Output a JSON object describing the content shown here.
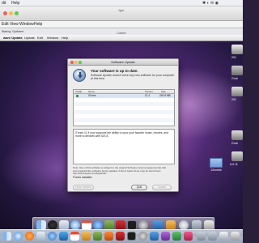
{
  "host_menubar": {
    "items": [
      "dit",
      "Help"
    ]
  },
  "host_window": {
    "title": "Igor",
    "menu": [
      "Edit",
      "View",
      "Window",
      "Help"
    ],
    "toolbar_status": [
      "Staring: Opdvane"
    ],
    "subtitle": "Caster"
  },
  "guest_menubar": {
    "items": [
      "ware Update",
      "Update",
      "Edit",
      "Window",
      "Help"
    ]
  },
  "desktop": {
    "folder_label": "1Zombie",
    "right_labels": [
      "201",
      "Grub",
      "201",
      "Grub",
      "A.0.11"
    ]
  },
  "dialog": {
    "title": "Software Update",
    "heading": "Your software is up to date.",
    "body": "Software Update doesn't have any new software for your computer at this time.",
    "table": {
      "columns": [
        "Install",
        "Name",
        "Version",
        "Size"
      ],
      "rows": [
        {
          "name": "iTunes",
          "version": "11.4",
          "size": "240.8 MB"
        }
      ]
    },
    "description": "iTunes 11.4 now supports the ability to sync your favorite music, movies, and more to devices with iOS 8.",
    "note": "Note: Use of this software is subject to the original Software License Agreement(s) that accompanied the software being updated. A list of Apple SLAs may be found here: http://www.apple.com/legal/sla/.",
    "status": "iTunes installed.",
    "buttons": {
      "hide": "Hide Details",
      "quit": "Quit",
      "install": "Install"
    }
  },
  "icons": {
    "dialog_icon": "software-update-icon",
    "dock": [
      "finder-icon",
      "dashboard-icon",
      "mail-icon",
      "safari-icon",
      "ical-icon",
      "itunes-icon",
      "preview-icon",
      "filezilla-icon",
      "terminal-icon",
      "settings-icon",
      "trash-icon"
    ]
  },
  "colors": {
    "accent": "#3d6fb0",
    "selection": "#dbe4f2",
    "installed": "#3fbf3f"
  }
}
